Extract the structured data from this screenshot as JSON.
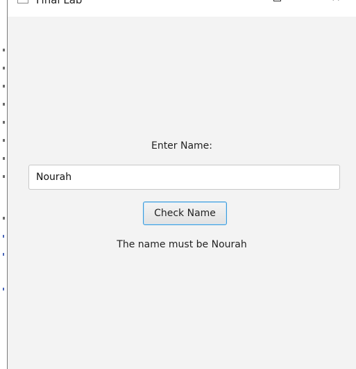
{
  "window": {
    "title": "Final Lab",
    "maximize_icon": "maximize-icon",
    "close_glyph": "✕"
  },
  "form": {
    "prompt_label": "Enter Name:",
    "name_value": "Nourah",
    "check_button_label": "Check Name",
    "result_message": "The name must be Nourah"
  },
  "colors": {
    "client_background": "#f3f3f3",
    "button_focus_border": "#3b9ad9"
  }
}
